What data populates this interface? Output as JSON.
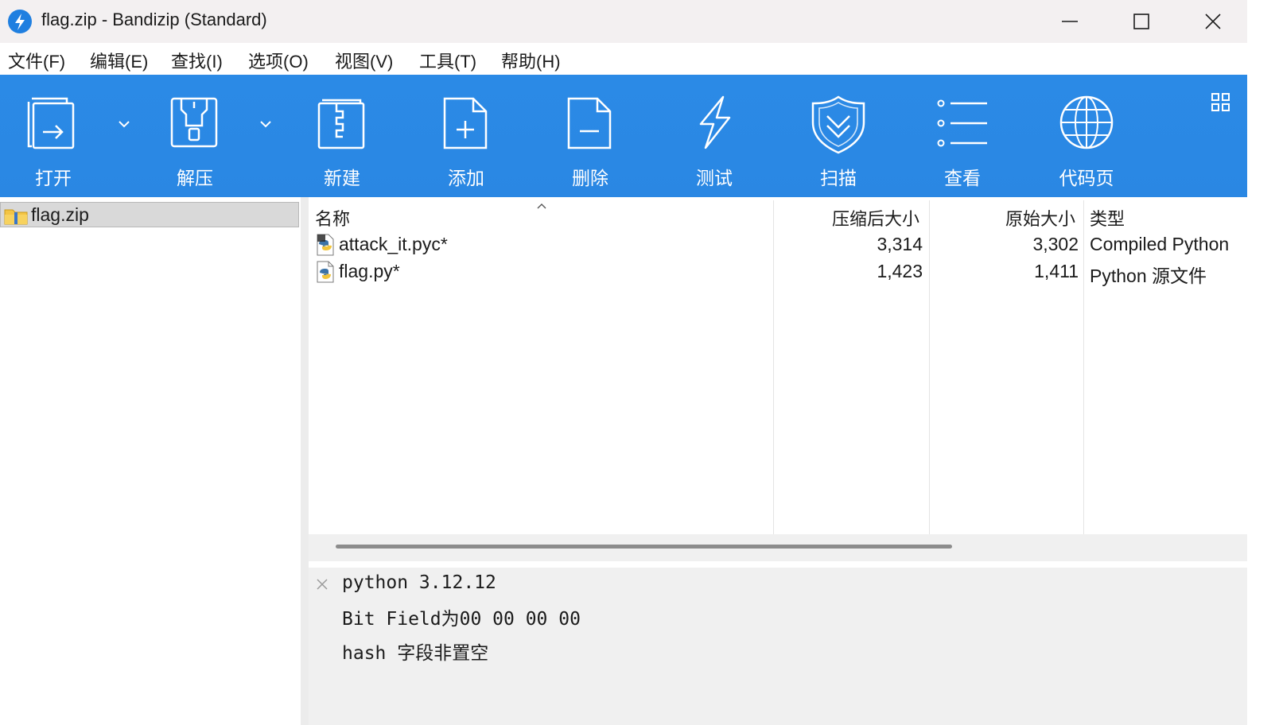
{
  "window": {
    "title": "flag.zip - Bandizip (Standard)",
    "controls": [
      "minimize",
      "maximize",
      "close"
    ]
  },
  "menu": [
    {
      "label": "文件(F)"
    },
    {
      "label": "编辑(E)"
    },
    {
      "label": "查找(I)"
    },
    {
      "label": "选项(O)"
    },
    {
      "label": "视图(V)"
    },
    {
      "label": "工具(T)"
    },
    {
      "label": "帮助(H)"
    }
  ],
  "toolbar": {
    "open": "打开",
    "extract": "解压",
    "new": "新建",
    "add": "添加",
    "delete": "删除",
    "test": "测试",
    "scan": "扫描",
    "view": "查看",
    "codepage": "代码页"
  },
  "tree": {
    "selected": "flag.zip"
  },
  "filelist": {
    "columns": {
      "name": "名称",
      "compressed": "压缩后大小",
      "original": "原始大小",
      "type": "类型"
    },
    "rows": [
      {
        "name": "attack_it.pyc*",
        "compressed": "3,314",
        "original": "3,302",
        "type": "Compiled Python",
        "icon": "python-compiled-icon"
      },
      {
        "name": "flag.py*",
        "compressed": "1,423",
        "original": "1,411",
        "type": "Python 源文件",
        "icon": "python-file-icon"
      }
    ]
  },
  "info": {
    "lines": [
      "python 3.12.12",
      "Bit Field为00 00 00 00",
      "hash 字段非置空"
    ]
  },
  "colors": {
    "toolbar": "#2b8ae6",
    "titlebar": "#f3f0f1",
    "selection": "#d9d9d9"
  }
}
